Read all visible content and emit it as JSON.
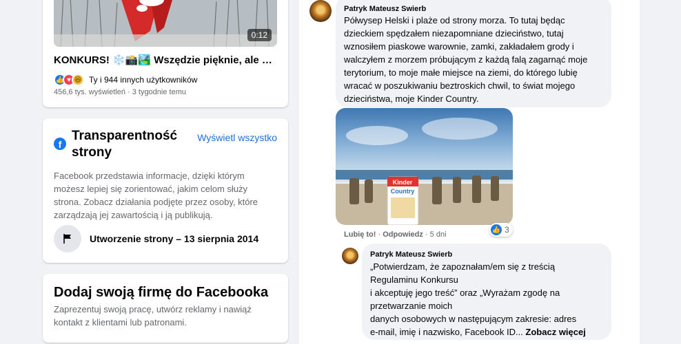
{
  "video": {
    "duration": "0:12",
    "title": "KONKURS! ❄️📸🏞️ Wszędzie pięknie, ale bli...",
    "reactions_text": "Ty i 944 innych użytkowników",
    "meta": "456,6 tys. wyświetleń · 3 tygodnie temu"
  },
  "transparency": {
    "title": "Transparentność strony",
    "see_all": "Wyświetl wszystko",
    "description": "Facebook przedstawia informacje, dzięki którym możesz lepiej się zorientować, jakim celom służy strona. Zobacz działania podjęte przez osoby, które zarządzają jej zawartością i ją publikują.",
    "created": "Utworzenie strony – 13 sierpnia 2014"
  },
  "business": {
    "title": "Dodaj swoją firmę do Facebooka",
    "description": "Zaprezentuj swoją pracę, utwórz reklamy i nawiąż kontakt z klientami lub patronami."
  },
  "comments": [
    {
      "author": "Patryk Mateusz Swierb",
      "text_lines": [
        "Półwysep Helski i plaże od strony morza. To tutaj będąc",
        "dzieckiem spędzałem niezapomniane dzieciństwo, tutaj",
        "wznosiłem piaskowe warownie, zamki, zakładałem grody i",
        "walczyłem z morzem próbującym z każdą falą zagarnąć moje",
        "terytorium, to moje małe miejsce na ziemi, do którego lubię",
        "wracać w poszukiwaniu beztroskich chwil, to świat mojego",
        "dzieciństwa, moje Kinder Country."
      ],
      "like_action": "Lubię to!",
      "reply_action": "Odpowiedz",
      "age": "5 dni",
      "like_count": "3",
      "photo_brand": "Kinder",
      "photo_product": "Country"
    },
    {
      "author": "Patryk Mateusz Swierb",
      "text_lines": [
        "„Potwierdzam, że zapoznałam/em się z treścią",
        "Regulaminu Konkursu",
        "i akceptuję jego treść” oraz „Wyrażam zgodę na",
        "przetwarzanie moich",
        "danych osobowych w następującym zakresie: adres"
      ],
      "last_line": "e-mail, imię i nazwisko, Facebook ID...",
      "see_more": "Zobacz więcej"
    }
  ],
  "colors": {
    "link": "#216fdb",
    "facebook_blue": "#1877f2",
    "bubble": "#f0f2f5",
    "background": "#f0f2f5"
  }
}
